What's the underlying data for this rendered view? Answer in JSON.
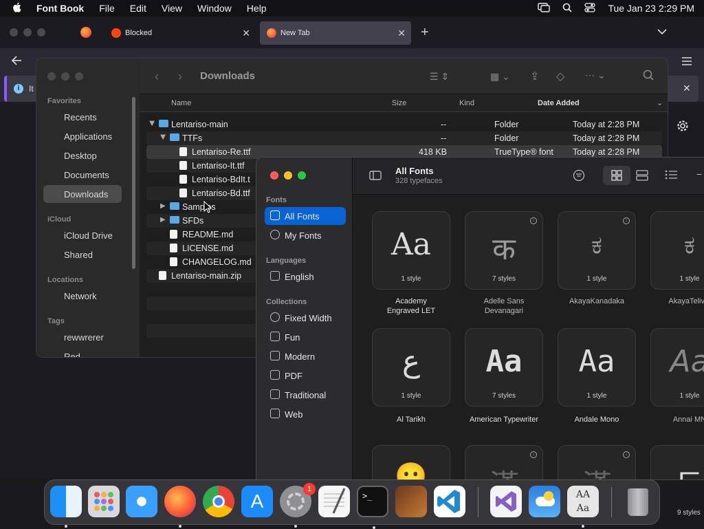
{
  "menubar": {
    "apple": "",
    "app": "Font Book",
    "items": [
      "File",
      "Edit",
      "View",
      "Window",
      "Help"
    ],
    "clock": "Tue Jan 23  2:29 PM"
  },
  "browser": {
    "tabs": [
      {
        "label": "Blocked"
      },
      {
        "label": "New Tab"
      }
    ],
    "notif_text": "It"
  },
  "finder": {
    "title": "Downloads",
    "sidebar": {
      "favorites_label": "Favorites",
      "favorites": [
        "Recents",
        "Applications",
        "Desktop",
        "Documents",
        "Downloads"
      ],
      "icloud_label": "iCloud",
      "icloud": [
        "iCloud Drive",
        "Shared"
      ],
      "locations_label": "Locations",
      "locations": [
        "Network"
      ],
      "tags_label": "Tags",
      "tags": [
        "rewwrerer",
        "Red"
      ]
    },
    "columns": {
      "name": "Name",
      "size": "Size",
      "kind": "Kind",
      "date": "Date Added"
    },
    "rows": [
      {
        "name": "Lentariso-main",
        "size": "--",
        "kind": "Folder",
        "date": "Today at 2:28 PM"
      },
      {
        "name": "TTFs",
        "size": "--",
        "kind": "Folder",
        "date": "Today at 2:28 PM"
      },
      {
        "name": "Lentariso-Re.ttf",
        "size": "418 KB",
        "kind": "TrueType® font",
        "date": "Today at 2:28 PM"
      },
      {
        "name": "Lentariso-It.ttf",
        "size": "",
        "kind": "",
        "date": ""
      },
      {
        "name": "Lentariso-BdIt.t",
        "size": "",
        "kind": "",
        "date": ""
      },
      {
        "name": "Lentariso-Bd.ttf",
        "size": "",
        "kind": "",
        "date": ""
      },
      {
        "name": "Samples",
        "size": "",
        "kind": "",
        "date": ""
      },
      {
        "name": "SFDs",
        "size": "",
        "kind": "",
        "date": ""
      },
      {
        "name": "README.md",
        "size": "",
        "kind": "",
        "date": ""
      },
      {
        "name": "LICENSE.md",
        "size": "",
        "kind": "",
        "date": ""
      },
      {
        "name": "CHANGELOG.md",
        "size": "",
        "kind": "",
        "date": ""
      },
      {
        "name": "Lentariso-main.zip",
        "size": "",
        "kind": "",
        "date": ""
      }
    ]
  },
  "fontbook": {
    "title": "All Fonts",
    "subtitle": "328 typefaces",
    "fonts_label": "Fonts",
    "fonts": [
      "All Fonts",
      "My Fonts"
    ],
    "languages_label": "Languages",
    "languages": [
      "English"
    ],
    "collections_label": "Collections",
    "collections": [
      "Fixed Width",
      "Fun",
      "Modern",
      "PDF",
      "Traditional",
      "Web"
    ],
    "cards": [
      {
        "glyph": "Aa",
        "styles": "1 style",
        "name": "Academy\nEngraved LET"
      },
      {
        "glyph": "क",
        "styles": "7 styles",
        "name": "Adelle Sans\nDevanagari"
      },
      {
        "glyph": "ಕ",
        "styles": "1 style",
        "name": "AkayaKanadaka"
      },
      {
        "glyph": "ಕ",
        "styles": "1 style",
        "name": "AkayaTelivig"
      },
      {
        "glyph": "ع",
        "styles": "1 style",
        "name": "Al Tarikh"
      },
      {
        "glyph": "Aa",
        "styles": "7 styles",
        "name": "American Typewriter"
      },
      {
        "glyph": "Aa",
        "styles": "1 style",
        "name": "Andale Mono"
      },
      {
        "glyph": "Aa",
        "styles": "1 style",
        "name": "Annai MN"
      },
      {
        "glyph": "😶",
        "styles": "",
        "name": ""
      },
      {
        "glyph": "漢",
        "styles": "",
        "name": ""
      },
      {
        "glyph": "漢",
        "styles": "",
        "name": ""
      },
      {
        "glyph": "동",
        "styles": "9 styles",
        "name": ""
      }
    ]
  },
  "dock": {
    "badge": "1"
  }
}
